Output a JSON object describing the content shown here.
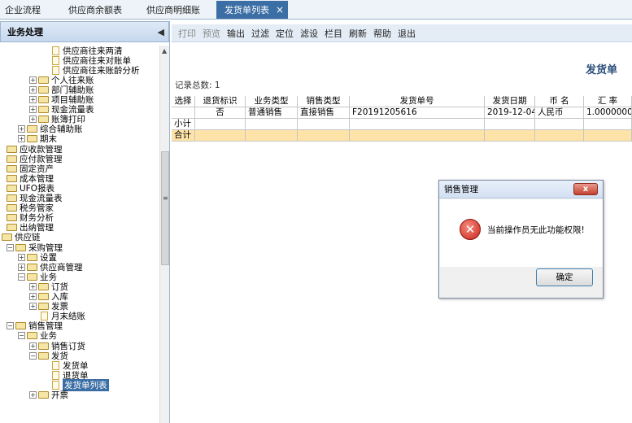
{
  "tabs": [
    {
      "label": "企业流程",
      "active": false
    },
    {
      "label": "供应商余额表",
      "active": false
    },
    {
      "label": "供应商明细账",
      "active": false
    },
    {
      "label": "发货单列表",
      "active": true
    }
  ],
  "tab_close_glyph": "×",
  "left_panel": {
    "title": "业务处理",
    "tree": [
      {
        "label": "供应商往来两清",
        "indent": 64,
        "icon": "doc",
        "pm": ""
      },
      {
        "label": "供应商往来对账单",
        "indent": 64,
        "icon": "doc",
        "pm": ""
      },
      {
        "label": "供应商往来账龄分析",
        "indent": 64,
        "icon": "doc",
        "pm": ""
      },
      {
        "label": "个人往来账",
        "indent": 36,
        "icon": "folder",
        "pm": "+"
      },
      {
        "label": "部门辅助账",
        "indent": 36,
        "icon": "folder",
        "pm": "+"
      },
      {
        "label": "项目辅助账",
        "indent": 36,
        "icon": "folder",
        "pm": "+"
      },
      {
        "label": "现金流量表",
        "indent": 36,
        "icon": "folder",
        "pm": "+"
      },
      {
        "label": "账簿打印",
        "indent": 36,
        "icon": "folder",
        "pm": "+"
      },
      {
        "label": "综合辅助账",
        "indent": 22,
        "icon": "folder",
        "pm": "+"
      },
      {
        "label": "期末",
        "indent": 22,
        "icon": "folder",
        "pm": "+"
      },
      {
        "label": "应收款管理",
        "indent": 8,
        "icon": "folder",
        "pm": ""
      },
      {
        "label": "应付款管理",
        "indent": 8,
        "icon": "folder",
        "pm": ""
      },
      {
        "label": "固定资产",
        "indent": 8,
        "icon": "folder",
        "pm": ""
      },
      {
        "label": "成本管理",
        "indent": 8,
        "icon": "folder",
        "pm": ""
      },
      {
        "label": "UFO报表",
        "indent": 8,
        "icon": "folder",
        "pm": ""
      },
      {
        "label": "现金流量表",
        "indent": 8,
        "icon": "folder",
        "pm": ""
      },
      {
        "label": "税务管家",
        "indent": 8,
        "icon": "folder",
        "pm": ""
      },
      {
        "label": "财务分析",
        "indent": 8,
        "icon": "folder",
        "pm": ""
      },
      {
        "label": "出纳管理",
        "indent": 8,
        "icon": "folder",
        "pm": ""
      },
      {
        "label": "供应链",
        "indent": 2,
        "icon": "folder",
        "pm": ""
      },
      {
        "label": "采购管理",
        "indent": 8,
        "icon": "folder",
        "pm": "-"
      },
      {
        "label": "设置",
        "indent": 22,
        "icon": "folder",
        "pm": "+"
      },
      {
        "label": "供应商管理",
        "indent": 22,
        "icon": "folder",
        "pm": "+"
      },
      {
        "label": "业务",
        "indent": 22,
        "icon": "folder",
        "pm": "-"
      },
      {
        "label": "订货",
        "indent": 36,
        "icon": "folder",
        "pm": "+"
      },
      {
        "label": "入库",
        "indent": 36,
        "icon": "folder",
        "pm": "+"
      },
      {
        "label": "发票",
        "indent": 36,
        "icon": "folder",
        "pm": "+"
      },
      {
        "label": "月末结账",
        "indent": 50,
        "icon": "doc",
        "pm": ""
      },
      {
        "label": "销售管理",
        "indent": 8,
        "icon": "folder",
        "pm": "-"
      },
      {
        "label": "业务",
        "indent": 22,
        "icon": "folder",
        "pm": "-"
      },
      {
        "label": "销售订货",
        "indent": 36,
        "icon": "folder",
        "pm": "+"
      },
      {
        "label": "发货",
        "indent": 36,
        "icon": "folder",
        "pm": "-"
      },
      {
        "label": "发货单",
        "indent": 64,
        "icon": "doc",
        "pm": ""
      },
      {
        "label": "退货单",
        "indent": 64,
        "icon": "doc",
        "pm": ""
      },
      {
        "label": "发货单列表",
        "indent": 64,
        "icon": "doc",
        "pm": "",
        "selected": true
      },
      {
        "label": "开票",
        "indent": 36,
        "icon": "folder",
        "pm": "+"
      }
    ]
  },
  "toolbar": [
    {
      "label": "打印",
      "disabled": true
    },
    {
      "label": "预览",
      "disabled": true
    },
    {
      "label": "输出",
      "disabled": false
    },
    {
      "label": "过滤",
      "disabled": false
    },
    {
      "label": "定位",
      "disabled": false
    },
    {
      "label": "滤设",
      "disabled": false
    },
    {
      "label": "栏目",
      "disabled": false
    },
    {
      "label": "刷新",
      "disabled": false
    },
    {
      "label": "帮助",
      "disabled": false
    },
    {
      "label": "退出",
      "disabled": false
    }
  ],
  "document_title": "发货单",
  "record_count": "记录总数: 1",
  "grid": {
    "columns": [
      "选择",
      "退货标识",
      "业务类型",
      "销售类型",
      "发货单号",
      "发货日期",
      "币 名",
      "汇 率"
    ],
    "rows": [
      [
        "",
        "否",
        "普通销售",
        "直接销售",
        "F20191205616",
        "2019-12-04",
        "人民币",
        "1.0000000"
      ]
    ],
    "subtotal_label": "小计",
    "total_label": "合计"
  },
  "dialog": {
    "title": "销售管理",
    "close_glyph": "x",
    "message": "当前操作员无此功能权限!",
    "ok_label": "确定"
  }
}
